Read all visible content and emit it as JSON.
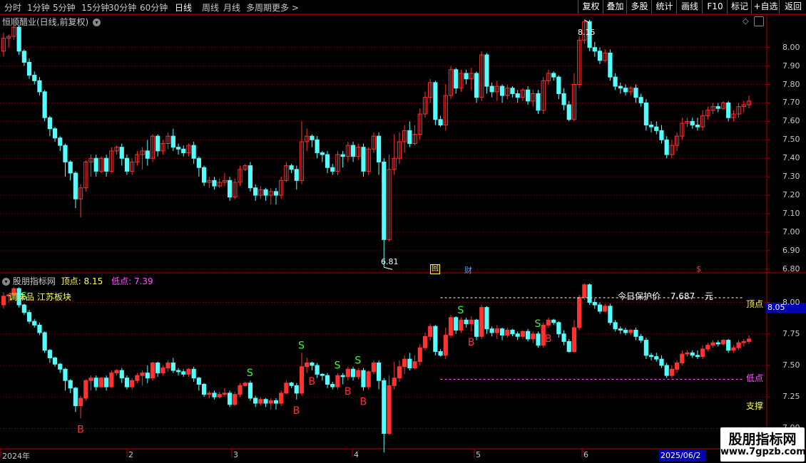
{
  "toolbar": {
    "timeframes": [
      "分时",
      "1分钟",
      "5分钟",
      "15分钟",
      "30分钟",
      "60分钟",
      "日线",
      "周线",
      "月线",
      "多周期",
      "更多 >"
    ],
    "right_buttons": [
      "复权",
      "叠加",
      "多股",
      "统计",
      "画线",
      "F10",
      "标记",
      "+自选",
      "返回"
    ]
  },
  "main_panel": {
    "title": "恒顺醋业(日线,前复权)",
    "high_label": "8.15",
    "low_label": "6.81",
    "y_ticks": [
      "8.00",
      "7.90",
      "7.80",
      "7.70",
      "7.60",
      "7.50",
      "7.40",
      "7.30",
      "7.20",
      "7.10",
      "7.00",
      "6.90",
      "6.80"
    ],
    "markers": [
      "回",
      "财",
      "$"
    ]
  },
  "indicator_panel": {
    "title": "股朋指标网",
    "top_label": "顶点:",
    "top_value": "8.15",
    "bottom_label": "低点:",
    "bottom_value": "7.39",
    "sector": "调味品 江苏板块",
    "protect_label": "今日保护价",
    "protect_value": "7.687",
    "protect_unit": "元",
    "line_top_label": "顶点",
    "line_bottom_label": "低点",
    "support_label": "支撑",
    "current_value": "8.05",
    "y_ticks": [
      "8.00",
      "7.75",
      "7.50",
      "7.25",
      "7.00"
    ],
    "signals_sell": "S",
    "signals_buy": "B"
  },
  "x_axis": {
    "labels": [
      "2024年",
      "2",
      "3",
      "4",
      "5",
      "6"
    ],
    "current_date": "2025/06/2"
  },
  "watermark": {
    "line1": "股朋指标网",
    "line2": "www.7gpzb.com"
  },
  "colors": {
    "up": "#ff3232",
    "down": "#54ffff",
    "grid": "#7a0000",
    "yellow": "#ffff54",
    "magenta": "#ff54ff",
    "green": "#32ff32"
  },
  "chart_data": {
    "type": "candlestick",
    "candles": [
      [
        7.98,
        8.05,
        7.95,
        8.08
      ],
      [
        8.05,
        8.06,
        8.0,
        8.07
      ],
      [
        8.06,
        8.11,
        8.04,
        8.12
      ],
      [
        8.11,
        7.98,
        7.96,
        8.12
      ],
      [
        7.98,
        7.92,
        7.9,
        7.99
      ],
      [
        7.92,
        7.85,
        7.83,
        7.94
      ],
      [
        7.85,
        7.82,
        7.8,
        7.87
      ],
      [
        7.82,
        7.76,
        7.74,
        7.84
      ],
      [
        7.76,
        7.62,
        7.6,
        7.77
      ],
      [
        7.62,
        7.56,
        7.52,
        7.63
      ],
      [
        7.56,
        7.51,
        7.49,
        7.57
      ],
      [
        7.51,
        7.47,
        7.44,
        7.52
      ],
      [
        7.47,
        7.38,
        7.3,
        7.48
      ],
      [
        7.38,
        7.32,
        7.28,
        7.39
      ],
      [
        7.32,
        7.18,
        7.13,
        7.33
      ],
      [
        7.18,
        7.24,
        7.08,
        7.26
      ],
      [
        7.24,
        7.38,
        7.22,
        7.39
      ],
      [
        7.38,
        7.4,
        7.3,
        7.42
      ],
      [
        7.4,
        7.33,
        7.3,
        7.42
      ],
      [
        7.33,
        7.4,
        7.32,
        7.41
      ],
      [
        7.4,
        7.33,
        7.3,
        7.42
      ],
      [
        7.33,
        7.44,
        7.32,
        7.46
      ],
      [
        7.44,
        7.46,
        7.42,
        7.47
      ],
      [
        7.46,
        7.4,
        7.36,
        7.48
      ],
      [
        7.4,
        7.33,
        7.31,
        7.42
      ],
      [
        7.33,
        7.38,
        7.31,
        7.4
      ],
      [
        7.38,
        7.42,
        7.36,
        7.44
      ],
      [
        7.42,
        7.44,
        7.34,
        7.46
      ],
      [
        7.44,
        7.4,
        7.36,
        7.5
      ],
      [
        7.4,
        7.52,
        7.38,
        7.53
      ],
      [
        7.52,
        7.44,
        7.41,
        7.53
      ],
      [
        7.44,
        7.48,
        7.42,
        7.5
      ],
      [
        7.48,
        7.52,
        7.45,
        7.54
      ],
      [
        7.52,
        7.46,
        7.44,
        7.56
      ],
      [
        7.46,
        7.45,
        7.42,
        7.48
      ],
      [
        7.45,
        7.43,
        7.41,
        7.47
      ],
      [
        7.43,
        7.47,
        7.41,
        7.48
      ],
      [
        7.47,
        7.4,
        7.37,
        7.49
      ],
      [
        7.4,
        7.35,
        7.3,
        7.41
      ],
      [
        7.35,
        7.27,
        7.25,
        7.36
      ],
      [
        7.27,
        7.28,
        7.24,
        7.3
      ],
      [
        7.28,
        7.25,
        7.23,
        7.3
      ],
      [
        7.25,
        7.27,
        7.24,
        7.29
      ],
      [
        7.27,
        7.28,
        7.25,
        7.32
      ],
      [
        7.28,
        7.19,
        7.17,
        7.3
      ],
      [
        7.19,
        7.27,
        7.18,
        7.29
      ],
      [
        7.27,
        7.34,
        7.25,
        7.36
      ],
      [
        7.34,
        7.36,
        7.33,
        7.37
      ],
      [
        7.36,
        7.24,
        7.22,
        7.38
      ],
      [
        7.24,
        7.2,
        7.17,
        7.26
      ],
      [
        7.2,
        7.23,
        7.18,
        7.25
      ],
      [
        7.23,
        7.2,
        7.17,
        7.24
      ],
      [
        7.2,
        7.22,
        7.15,
        7.24
      ],
      [
        7.22,
        7.2,
        7.15,
        7.24
      ],
      [
        7.2,
        7.28,
        7.18,
        7.3
      ],
      [
        7.28,
        7.36,
        7.27,
        7.38
      ],
      [
        7.36,
        7.34,
        7.32,
        7.37
      ],
      [
        7.34,
        7.28,
        7.23,
        7.36
      ],
      [
        7.28,
        7.49,
        7.26,
        7.6
      ],
      [
        7.49,
        7.52,
        7.44,
        7.56
      ],
      [
        7.52,
        7.5,
        7.46,
        7.53
      ],
      [
        7.5,
        7.43,
        7.4,
        7.52
      ],
      [
        7.43,
        7.42,
        7.38,
        7.44
      ],
      [
        7.42,
        7.35,
        7.32,
        7.44
      ],
      [
        7.35,
        7.33,
        7.31,
        7.37
      ],
      [
        7.33,
        7.42,
        7.31,
        7.44
      ],
      [
        7.42,
        7.41,
        7.35,
        7.44
      ],
      [
        7.41,
        7.47,
        7.38,
        7.49
      ],
      [
        7.47,
        7.41,
        7.38,
        7.49
      ],
      [
        7.41,
        7.46,
        7.39,
        7.48
      ],
      [
        7.46,
        7.33,
        7.3,
        7.48
      ],
      [
        7.33,
        7.45,
        7.31,
        7.46
      ],
      [
        7.45,
        7.52,
        7.43,
        7.54
      ],
      [
        7.52,
        7.38,
        7.31,
        7.54
      ],
      [
        7.38,
        6.96,
        6.81,
        7.4
      ],
      [
        6.96,
        7.34,
        6.95,
        7.42
      ],
      [
        7.34,
        7.4,
        7.31,
        7.53
      ],
      [
        7.4,
        7.49,
        7.37,
        7.54
      ],
      [
        7.49,
        7.55,
        7.43,
        7.58
      ],
      [
        7.55,
        7.48,
        7.46,
        7.6
      ],
      [
        7.48,
        7.53,
        7.47,
        7.58
      ],
      [
        7.53,
        7.64,
        7.5,
        7.67
      ],
      [
        7.64,
        7.73,
        7.62,
        7.76
      ],
      [
        7.73,
        7.81,
        7.7,
        7.83
      ],
      [
        7.81,
        7.61,
        7.58,
        7.82
      ],
      [
        7.61,
        7.58,
        7.57,
        7.63
      ],
      [
        7.58,
        7.74,
        7.55,
        7.8
      ],
      [
        7.74,
        7.88,
        7.72,
        7.9
      ],
      [
        7.88,
        7.78,
        7.75,
        7.89
      ],
      [
        7.78,
        7.86,
        7.76,
        7.88
      ],
      [
        7.86,
        7.83,
        7.8,
        7.88
      ],
      [
        7.83,
        7.86,
        7.77,
        7.89
      ],
      [
        7.86,
        7.73,
        7.7,
        7.87
      ],
      [
        7.73,
        7.96,
        7.71,
        7.98
      ],
      [
        7.96,
        7.79,
        7.75,
        7.97
      ],
      [
        7.79,
        7.76,
        7.73,
        7.81
      ],
      [
        7.76,
        7.79,
        7.71,
        7.82
      ],
      [
        7.79,
        7.74,
        7.7,
        7.8
      ],
      [
        7.74,
        7.78,
        7.72,
        7.8
      ],
      [
        7.78,
        7.75,
        7.73,
        7.79
      ],
      [
        7.75,
        7.73,
        7.7,
        7.77
      ],
      [
        7.73,
        7.77,
        7.71,
        7.78
      ],
      [
        7.77,
        7.71,
        7.69,
        7.79
      ],
      [
        7.71,
        7.75,
        7.68,
        7.77
      ],
      [
        7.75,
        7.66,
        7.64,
        7.77
      ],
      [
        7.66,
        7.82,
        7.64,
        7.84
      ],
      [
        7.82,
        7.86,
        7.8,
        7.88
      ],
      [
        7.86,
        7.84,
        7.82,
        7.87
      ],
      [
        7.84,
        7.75,
        7.72,
        7.85
      ],
      [
        7.75,
        7.69,
        7.66,
        7.78
      ],
      [
        7.69,
        7.61,
        7.6,
        7.71
      ],
      [
        7.61,
        7.8,
        7.6,
        7.86
      ],
      [
        7.8,
        8.04,
        7.78,
        8.06
      ],
      [
        8.04,
        8.14,
        8.02,
        8.15
      ],
      [
        8.14,
        8.0,
        7.98,
        8.15
      ],
      [
        8.0,
        7.98,
        7.95,
        8.03
      ],
      [
        7.98,
        7.93,
        7.91,
        8.0
      ],
      [
        7.93,
        7.97,
        7.92,
        7.99
      ],
      [
        7.97,
        7.84,
        7.82,
        7.99
      ],
      [
        7.84,
        7.79,
        7.77,
        7.86
      ],
      [
        7.79,
        7.78,
        7.75,
        7.81
      ],
      [
        7.78,
        7.76,
        7.74,
        7.8
      ],
      [
        7.76,
        7.78,
        7.74,
        7.79
      ],
      [
        7.78,
        7.73,
        7.7,
        7.8
      ],
      [
        7.73,
        7.7,
        7.68,
        7.75
      ],
      [
        7.7,
        7.58,
        7.55,
        7.72
      ],
      [
        7.58,
        7.57,
        7.54,
        7.6
      ],
      [
        7.57,
        7.55,
        7.53,
        7.6
      ],
      [
        7.55,
        7.5,
        7.48,
        7.58
      ],
      [
        7.5,
        7.42,
        7.4,
        7.52
      ],
      [
        7.42,
        7.47,
        7.4,
        7.5
      ],
      [
        7.47,
        7.52,
        7.44,
        7.54
      ],
      [
        7.52,
        7.59,
        7.5,
        7.62
      ],
      [
        7.59,
        7.6,
        7.57,
        7.62
      ],
      [
        7.6,
        7.58,
        7.56,
        7.62
      ],
      [
        7.58,
        7.57,
        7.55,
        7.62
      ],
      [
        7.57,
        7.63,
        7.55,
        7.66
      ],
      [
        7.63,
        7.66,
        7.61,
        7.68
      ],
      [
        7.66,
        7.68,
        7.64,
        7.7
      ],
      [
        7.68,
        7.67,
        7.65,
        7.7
      ],
      [
        7.67,
        7.7,
        7.66,
        7.71
      ],
      [
        7.7,
        7.62,
        7.6,
        7.71
      ],
      [
        7.62,
        7.64,
        7.6,
        7.66
      ],
      [
        7.64,
        7.68,
        7.62,
        7.7
      ],
      [
        7.68,
        7.69,
        7.65,
        7.71
      ],
      [
        7.69,
        7.71,
        7.67,
        7.74
      ]
    ],
    "candle_format": "[open, close, low, high]",
    "ylim_main": [
      6.78,
      8.18
    ],
    "ylim_indicator": [
      6.85,
      8.15
    ]
  }
}
